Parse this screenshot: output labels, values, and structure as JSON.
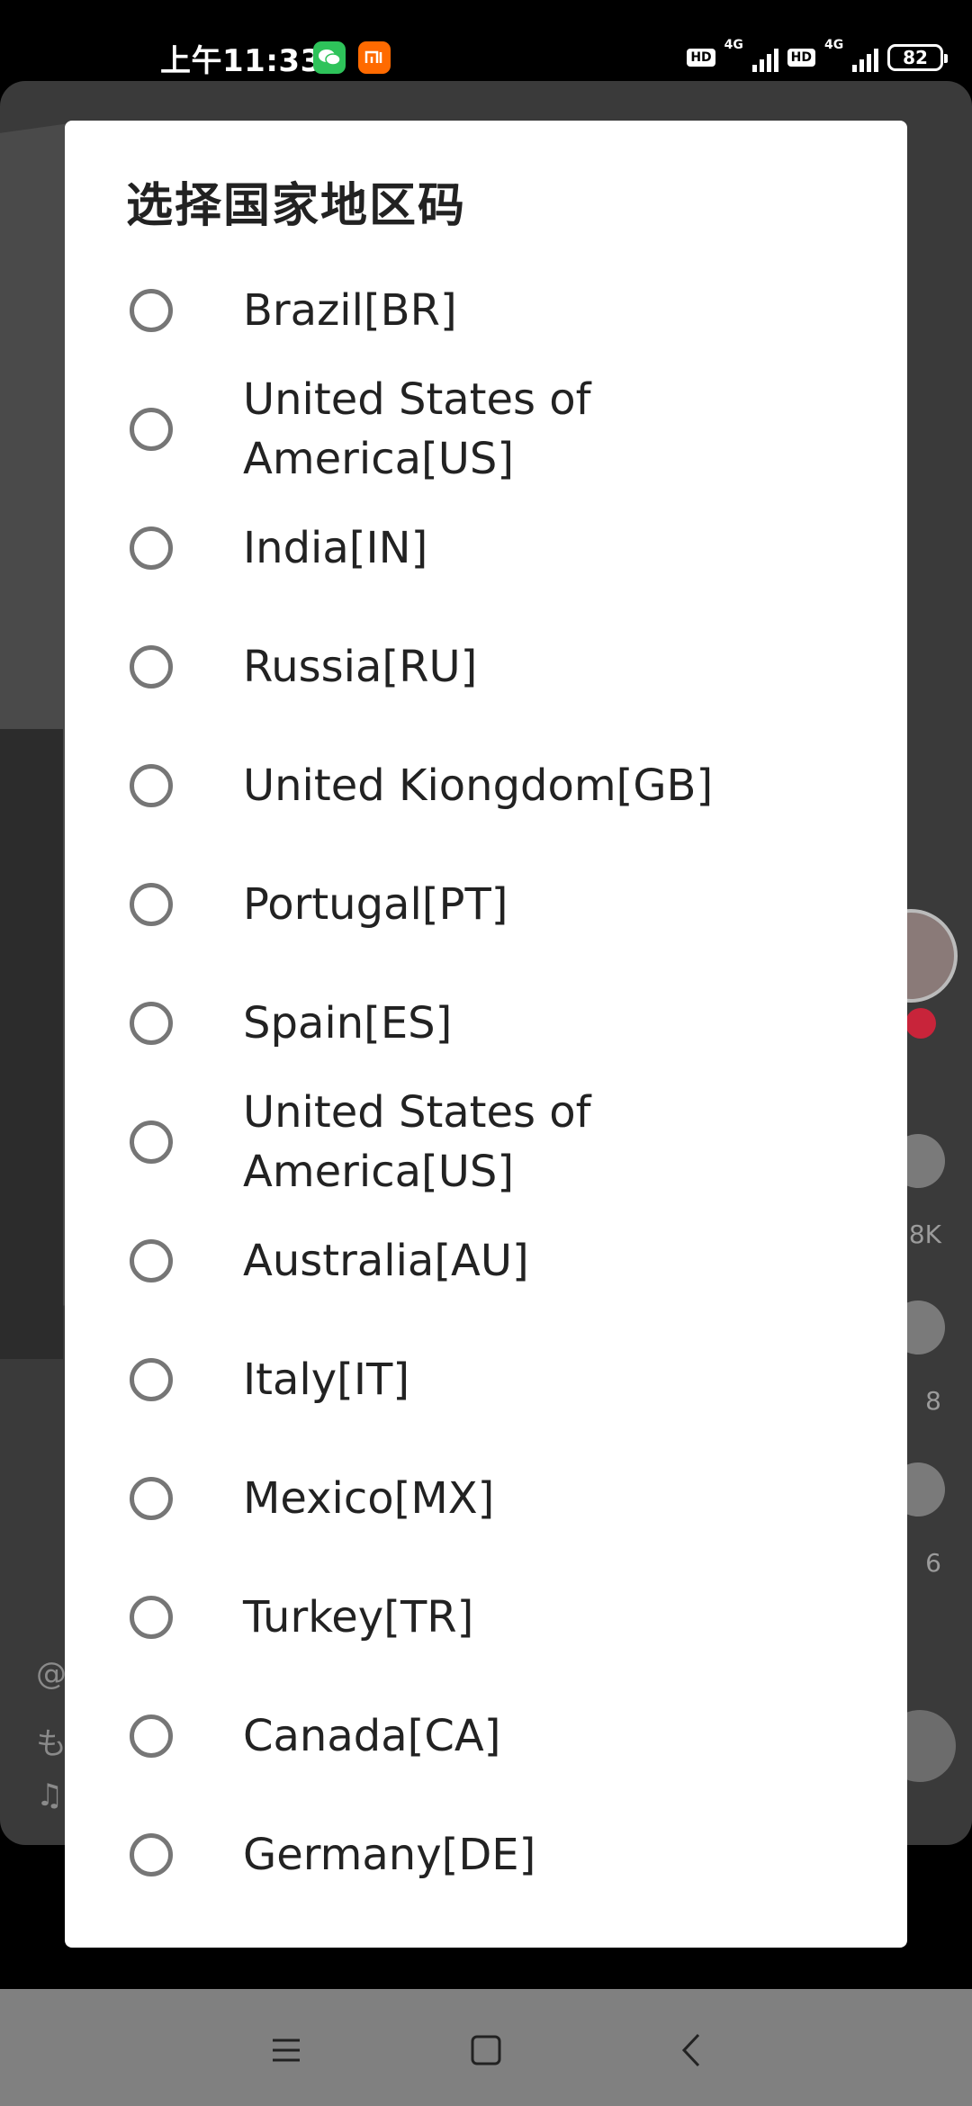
{
  "status_bar": {
    "time": "上午11:33",
    "wechat_icon": "wechat-icon",
    "mi_icon": "mi-icon",
    "hd1": "HD",
    "net1": "4G",
    "hd2": "HD",
    "net2": "4G",
    "battery": "82"
  },
  "background_app": {
    "count1": "8K",
    "count2": "8",
    "count3": "6",
    "text1": "@",
    "text2": "も",
    "text3": "♫"
  },
  "dialog": {
    "title": "选择国家地区码",
    "options": [
      {
        "label": "Brazil[BR]",
        "selected": false
      },
      {
        "label": "United States of America[US]",
        "selected": false
      },
      {
        "label": "India[IN]",
        "selected": false
      },
      {
        "label": "Russia[RU]",
        "selected": false
      },
      {
        "label": "United Kiongdom[GB]",
        "selected": false
      },
      {
        "label": "Portugal[PT]",
        "selected": false
      },
      {
        "label": "Spain[ES]",
        "selected": false
      },
      {
        "label": "United States of America[US]",
        "selected": false
      },
      {
        "label": "Australia[AU]",
        "selected": false
      },
      {
        "label": "Italy[IT]",
        "selected": false
      },
      {
        "label": "Mexico[MX]",
        "selected": false
      },
      {
        "label": "Turkey[TR]",
        "selected": false
      },
      {
        "label": "Canada[CA]",
        "selected": false
      },
      {
        "label": "Germany[DE]",
        "selected": false
      }
    ]
  },
  "nav_bar": {
    "menu_icon": "menu-icon",
    "home_icon": "home-square-icon",
    "back_icon": "back-chevron-icon"
  },
  "colors": {
    "dialog_bg": "#ffffff",
    "radio_border": "#767676",
    "text": "#222222",
    "nav_bg": "#808080"
  }
}
